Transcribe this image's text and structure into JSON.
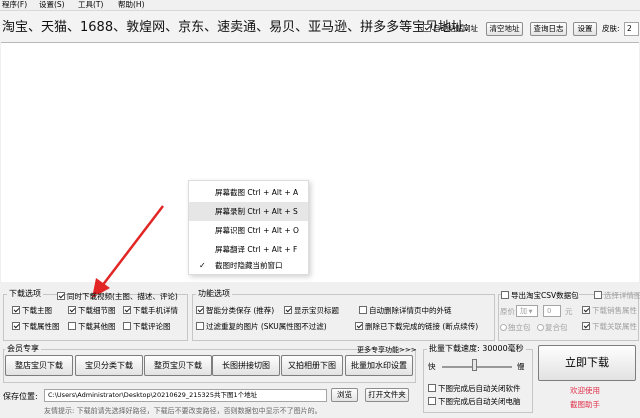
{
  "menu": {
    "items": [
      "程序(F)",
      "设置(S)",
      "工具(T)",
      "帮助(H)"
    ]
  },
  "topbar": {
    "sites_text": "淘宝、天猫、1688、敦煌网、京东、速卖通、易贝、亚马逊、拼多多等宝贝地址:",
    "auto_paste_label": "自动粘贴网址",
    "clear_label": "清空地址",
    "search_log_label": "查询日志",
    "settings_label": "设置",
    "skin_label": "皮肤:",
    "skin_value": "2"
  },
  "context_menu": {
    "items": [
      {
        "label": "屏幕截图 Ctrl + Alt + A",
        "highlighted": false
      },
      {
        "label": "屏幕录制 Ctrl + Alt + S",
        "highlighted": true
      },
      {
        "label": "屏幕识图 Ctrl + Alt + O",
        "highlighted": false
      },
      {
        "label": "屏幕翻译 Ctrl + Alt + F",
        "highlighted": false
      },
      {
        "label": "截图时隐藏当前窗口",
        "highlighted": false,
        "checked": true
      }
    ]
  },
  "download_options": {
    "title": "下载选项",
    "video_label": "同时下载视频(主图、描述、评论)",
    "main_image": "下载主图",
    "detail_image": "下载细节图",
    "mobile_detail": "下载手机详情",
    "attribute_image": "下载属性图",
    "other_image": "下载其他图",
    "review_image": "下载评论图"
  },
  "feature_options": {
    "title": "功能选项",
    "smart_save": "智能分类保存 (推荐)",
    "show_title": "显示宝贝标题",
    "auto_delete_links": "自动删除详情页中的外链",
    "filter_duplicates": "过滤重复的图片 (SKU属性图不过滤)",
    "delete_downloaded": "删除已下载完成的链接 (断点续传)"
  },
  "csv_options": {
    "export_csv": "导出淘宝CSV数据包",
    "select_detail": "选择详情图",
    "original_price_label": "原价",
    "operator_value": "加",
    "amount_value": "0",
    "unit": "元",
    "download_sales_attr": "下载销售属性",
    "standalone": "独立包",
    "combined": "复合包",
    "download_sku_attr": "下载关联属性"
  },
  "member": {
    "title": "会员专享",
    "more_label": "更多专享功能>>>",
    "buttons": [
      "整店宝贝下载",
      "宝贝分类下载",
      "整页宝贝下载",
      "长图拼接切图",
      "又拍相册下图",
      "批量加水印设置"
    ]
  },
  "batch": {
    "title": "批量下载速度: 30000毫秒",
    "fast": "快",
    "slow": "慢",
    "download_now": "立即下载",
    "shutdown_software": "下图完成后自动关闭软件",
    "shutdown_pc": "下图完成后自动关闭电脑",
    "welcome": "欢迎使用",
    "assistant": "截图助手"
  },
  "save": {
    "label": "保存位置:",
    "path": "C:\\Users\\Administrator\\Desktop\\20210629_215325共下图1个地址",
    "browse": "浏览",
    "open_folder": "打开文件夹",
    "tip": "友情提示: 下载前请先选择好路径，下载后不要改变路径，否则数据包中显示不了图片的。"
  },
  "colors": {
    "accent_red": "#e0314b",
    "arrow_red": "#e22525"
  }
}
